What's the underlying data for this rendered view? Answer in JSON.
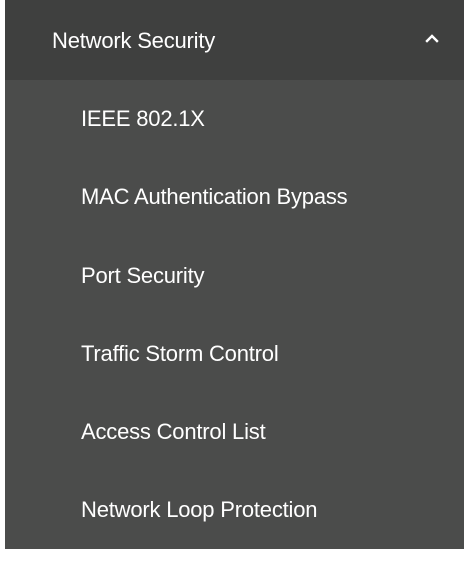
{
  "colors": {
    "header_background": "#3f403f",
    "panel_background": "#4b4c4b",
    "text": "#ffffff"
  },
  "menu": {
    "header": {
      "label": "Network Security",
      "icon": "chevron-up-icon",
      "expanded": true
    },
    "items": [
      {
        "label": "IEEE 802.1X"
      },
      {
        "label": "MAC Authentication Bypass"
      },
      {
        "label": "Port Security"
      },
      {
        "label": "Traffic Storm Control"
      },
      {
        "label": "Access Control List"
      },
      {
        "label": "Network Loop Protection"
      }
    ]
  }
}
